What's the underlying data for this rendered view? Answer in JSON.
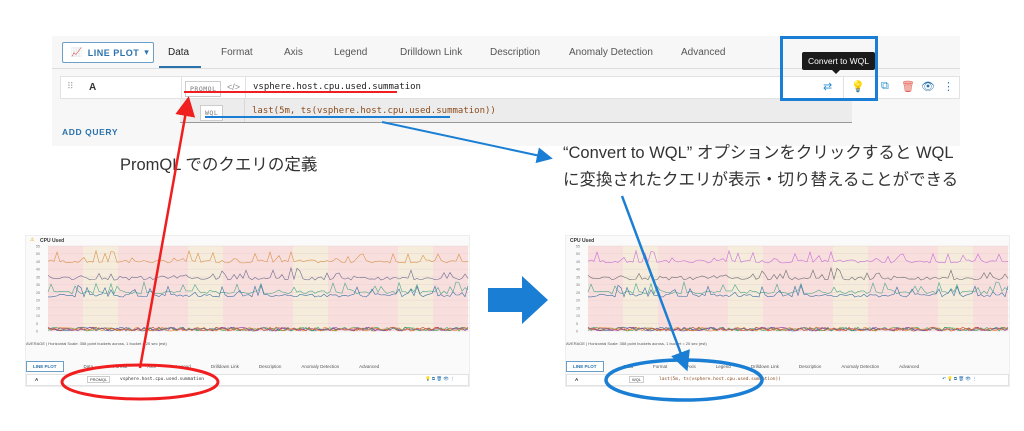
{
  "editor": {
    "chart_type_button": "LINE PLOT",
    "tabs": [
      "Data",
      "Format",
      "Axis",
      "Legend",
      "Drilldown Link",
      "Description",
      "Anomaly Detection",
      "Advanced"
    ],
    "active_tab": "Data",
    "query": {
      "label": "A",
      "mode_badge": "PROMQL",
      "code_toggle": "</>",
      "value": "vsphere.host.cpu.used.summation"
    },
    "converted": {
      "mode_badge": "WQL",
      "value": "last(5m, ts(vsphere.host.cpu.used.summation))"
    },
    "tooltip": "Convert to WQL",
    "add_query": "ADD QUERY"
  },
  "annotations": {
    "left_caption": "PromQL でのクエリの定義",
    "right_caption_line1": "“Convert to WQL” オプションをクリックすると WQL",
    "right_caption_line2": "に変換されたクエリが表示・切り替えることができる",
    "colors": {
      "red": "#f01e1e",
      "blue": "#1a7fd4"
    }
  },
  "screenshots": {
    "chart_title": "CPU Used",
    "y_ticks": [
      "55",
      "50",
      "45",
      "40",
      "35",
      "30",
      "25",
      "20",
      "15",
      "10",
      "5",
      "0"
    ],
    "avg_text": "AVERAGE | Horizontal Scale: 358 point buckets across, 1 bucket = 20 sec (est)",
    "before_query": "vsphere.host.cpu.used.summation",
    "before_badge": "PROMQL",
    "after_query": "last(5m, ts(vsphere.host.cpu.used.summation))",
    "after_badge": "WQL"
  }
}
